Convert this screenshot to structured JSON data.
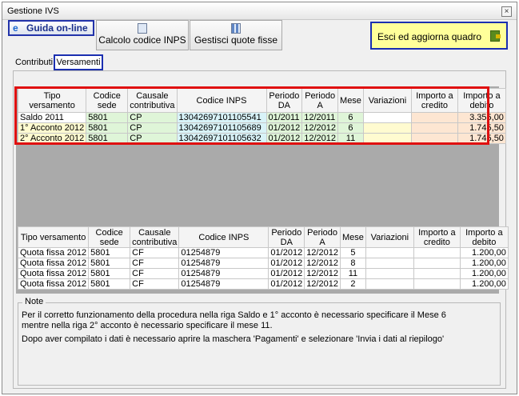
{
  "window": {
    "title": "Gestione IVS",
    "close_symbol": "×"
  },
  "toolbar": {
    "guida_label": "Guida on-line",
    "calcolo_label": "Calcolo codice INPS",
    "quote_label": "Gestisci quote fisse",
    "esci_label": "Esci ed aggiorna quadro"
  },
  "icons": {
    "guida": "ie-icon",
    "calcolo": "magnifier-icon",
    "quote": "grid-icon",
    "esci": "exit-door-icon"
  },
  "tabs": {
    "contributi": "Contributi",
    "versamenti": "Versamenti"
  },
  "columns": [
    "Tipo versamento",
    "Codice sede",
    "Causale contributiva",
    "Codice INPS",
    "Periodo DA",
    "Periodo A",
    "Mese",
    "Variazioni",
    "Importo a credito",
    "Importo a debito"
  ],
  "top_rows": [
    {
      "tipo": "Saldo 2011",
      "sede": "5801",
      "causale": "CP",
      "inps": "13042697101105541",
      "da": "01/2011",
      "a": "12/2011",
      "mese": "6",
      "variazioni": "",
      "credito": "",
      "debito": "3.355,00"
    },
    {
      "tipo": "1° Acconto 2012",
      "sede": "5801",
      "causale": "CP",
      "inps": "13042697101105689",
      "da": "01/2012",
      "a": "12/2012",
      "mese": "6",
      "variazioni": "",
      "credito": "",
      "debito": "1.745,50"
    },
    {
      "tipo": "2° Acconto 2012",
      "sede": "5801",
      "causale": "CP",
      "inps": "13042697101105632",
      "da": "01/2012",
      "a": "12/2012",
      "mese": "11",
      "variazioni": "",
      "credito": "",
      "debito": "1.745,50"
    }
  ],
  "bottom_rows": [
    {
      "tipo": "Quota fissa 2012",
      "sede": "5801",
      "causale": "CF",
      "inps": "01254879",
      "da": "01/2012",
      "a": "12/2012",
      "mese": "5",
      "variazioni": "",
      "credito": "",
      "debito": "1.200,00"
    },
    {
      "tipo": "Quota fissa 2012",
      "sede": "5801",
      "causale": "CF",
      "inps": "01254879",
      "da": "01/2012",
      "a": "12/2012",
      "mese": "8",
      "variazioni": "",
      "credito": "",
      "debito": "1.200,00"
    },
    {
      "tipo": "Quota fissa 2012",
      "sede": "5801",
      "causale": "CF",
      "inps": "01254879",
      "da": "01/2012",
      "a": "12/2012",
      "mese": "11",
      "variazioni": "",
      "credito": "",
      "debito": "1.200,00"
    },
    {
      "tipo": "Quota fissa 2012",
      "sede": "5801",
      "causale": "CF",
      "inps": "01254879",
      "da": "01/2012",
      "a": "12/2012",
      "mese": "2",
      "variazioni": "",
      "credito": "",
      "debito": "1.200,00"
    }
  ],
  "note": {
    "title": "Note",
    "line1": "Per il corretto funzionamento della procedura nella riga Saldo e 1° acconto è necessario specificare il Mese 6",
    "line2": "mentre nella riga 2° acconto è necessario specificare il mese 11.",
    "line3": "Dopo aver compilato i dati è necessario aprire la maschera 'Pagamenti' e selezionare 'Invia i dati al riepilogo'"
  },
  "colors": {
    "highlight_border": "#e01010",
    "focus_border": "#1b2fb0",
    "esci_bg": "#ffff9a"
  }
}
